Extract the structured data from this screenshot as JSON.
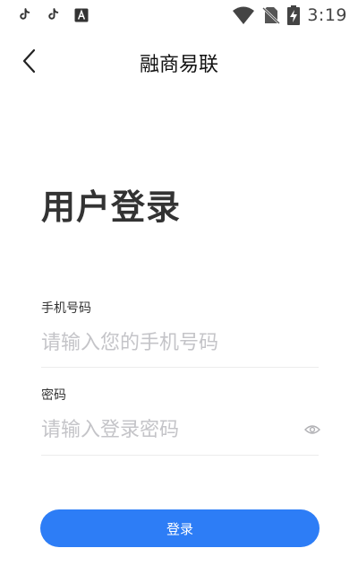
{
  "status_bar": {
    "time": "3:19",
    "left_icons": [
      "tiktok-icon",
      "tiktok-icon",
      "font-download-icon"
    ],
    "right_icons": [
      "wifi-icon",
      "no-sim-icon",
      "battery-charging-icon"
    ]
  },
  "header": {
    "title": "融商易联",
    "back_icon": "chevron-left-icon"
  },
  "page": {
    "heading": "用户登录"
  },
  "form": {
    "phone_label": "手机号码",
    "phone_placeholder": "请输入您的手机号码",
    "phone_value": "",
    "password_label": "密码",
    "password_placeholder": "请输入登录密码",
    "password_value": "",
    "eye_icon": "eye-icon",
    "submit_label": "登录"
  },
  "colors": {
    "primary": "#2d7df6",
    "placeholder": "#c4c4c8",
    "divider": "#ececec"
  }
}
